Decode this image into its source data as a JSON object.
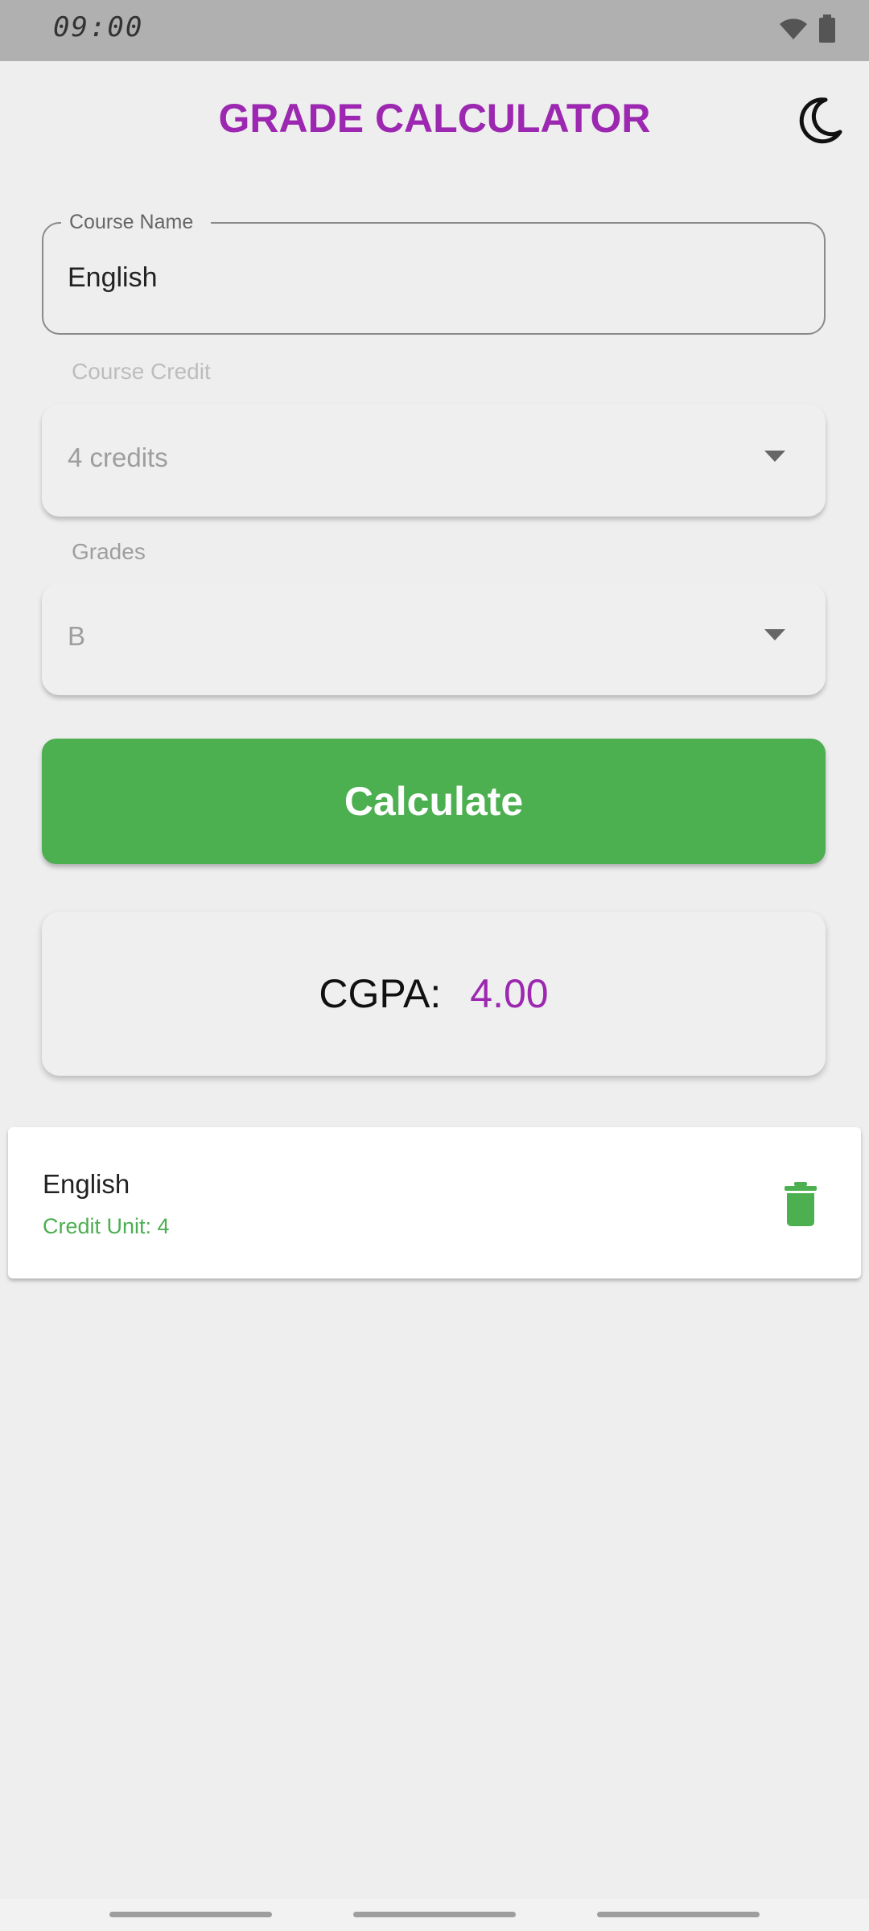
{
  "status_bar": {
    "time": "09:00",
    "icons": [
      "wifi-icon",
      "battery-icon"
    ]
  },
  "header": {
    "title": "GRADE CALCULATOR",
    "theme_toggle_icon": "moon-icon"
  },
  "form": {
    "course_name": {
      "label": "Course Name",
      "value": "English"
    },
    "course_credit": {
      "label": "Course Credit",
      "selected": "4 credits"
    },
    "grades": {
      "label": "Grades",
      "selected": "B"
    },
    "calculate_label": "Calculate"
  },
  "result": {
    "label": "CGPA:",
    "value": "4.00"
  },
  "courses": [
    {
      "name": "English",
      "credit_text": "Credit Unit: 4",
      "delete_icon": "trash-icon"
    }
  ],
  "colors": {
    "title": "#9c27b0",
    "accent": "#4caf50",
    "cgpa_value": "#9c27b0",
    "background": "#eeeeee",
    "status_bar": "#b0b0b0"
  }
}
